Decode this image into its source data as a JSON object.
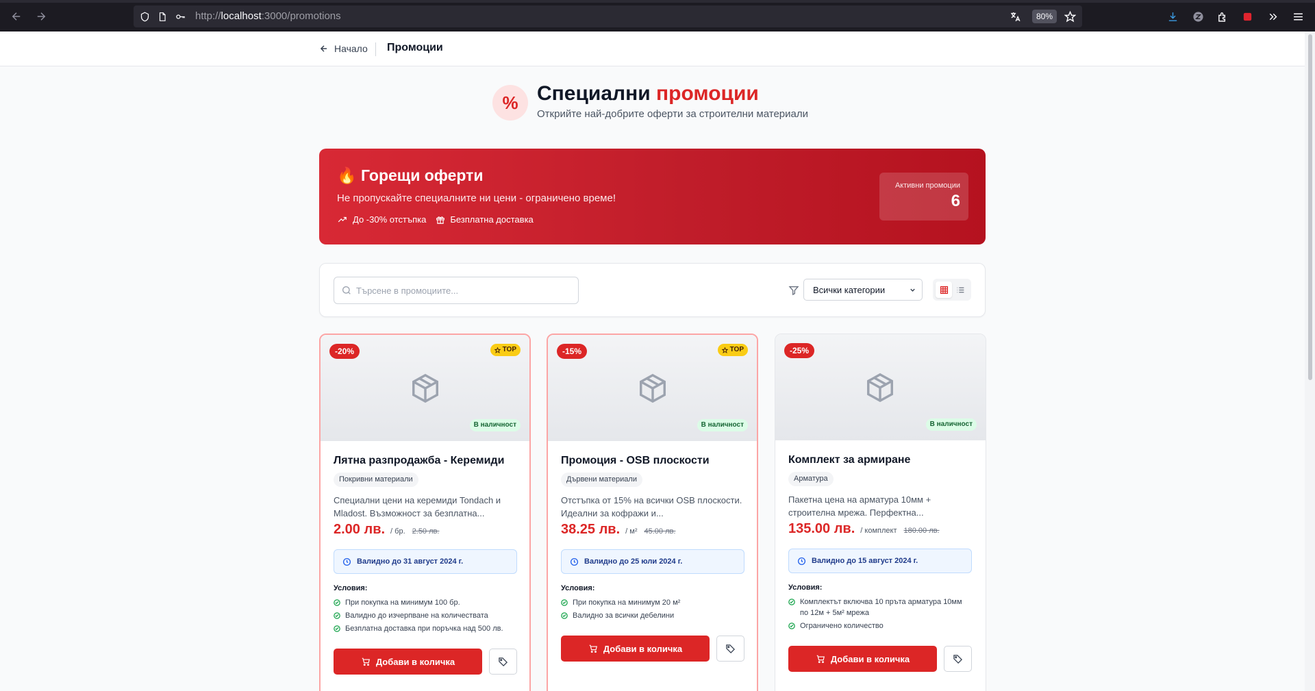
{
  "browser": {
    "url_prefix": "http://",
    "url_host": "localhost",
    "url_path": ":3000/promotions",
    "zoom": "80%"
  },
  "header": {
    "back_label": "Начало",
    "title": "Промоции"
  },
  "hero": {
    "icon": "percent-icon",
    "title_main": "Специални",
    "title_accent": "промоции",
    "subtitle": "Открийте най-добрите оферти за строителни материали"
  },
  "banner": {
    "title": "🔥 Горещи оферти",
    "subtitle": "Не пропускайте специалните ни цени - ограничено време!",
    "feature1": "До -30% отстъпка",
    "feature2": "Безплатна доставка",
    "stat_label": "Активни промоции",
    "stat_value": "6"
  },
  "toolbar": {
    "search_placeholder": "Търсене в промоциите...",
    "category_selected": "Всички категории"
  },
  "common": {
    "top_label": "TOP",
    "stock_label": "В наличност",
    "conditions_label": "Условия:",
    "add_to_cart": "Добави в количка"
  },
  "colors": {
    "accent": "#dc2626",
    "banner_start": "#d82935",
    "banner_end": "#b5121f",
    "validity_bg": "#eff6ff",
    "stock_bg": "#dcfce7"
  },
  "promotions": [
    {
      "discount": "-20%",
      "top": true,
      "title": "Лятна разпродажба - Керемиди",
      "category": "Покривни материали",
      "description": "Специални цени на керемиди Tondach и Mladost. Възможност за безплатна...",
      "price": "2.00 лв.",
      "unit": "/ бр.",
      "old_price": "2.50 лв.",
      "valid_until": "Валидно до 31 август 2024 г.",
      "conditions": [
        "При покупка на минимум 100 бр.",
        "Валидно до изчерпване на количествата",
        "Безплатна доставка при поръчка над 500 лв."
      ]
    },
    {
      "discount": "-15%",
      "top": true,
      "title": "Промоция - OSB плоскости",
      "category": "Дървени материали",
      "description": "Отстъпка от 15% на всички OSB плоскости. Идеални за кофражи и...",
      "price": "38.25 лв.",
      "unit": "/ м²",
      "old_price": "45.00 лв.",
      "valid_until": "Валидно до 25 юли 2024 г.",
      "conditions": [
        "При покупка на минимум 20 м²",
        "Валидно за всички дебелини"
      ]
    },
    {
      "discount": "-25%",
      "top": false,
      "title": "Комплект за армиране",
      "category": "Арматура",
      "description": "Пакетна цена на арматура 10мм + строителна мрежа. Перфектна...",
      "price": "135.00 лв.",
      "unit": "/ комплект",
      "old_price": "180.00 лв.",
      "valid_until": "Валидно до 15 август 2024 г.",
      "conditions": [
        "Комплектът включва 10 пръта арматура 10мм по 12м + 5м² мрежа",
        "Ограничено количество"
      ]
    }
  ]
}
